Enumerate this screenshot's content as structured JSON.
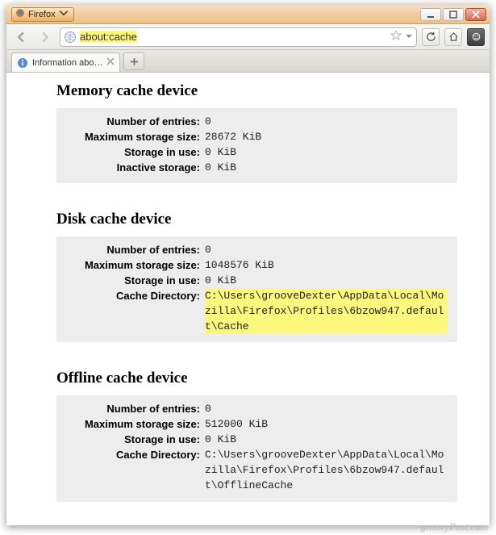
{
  "window": {
    "app_name": "Firefox",
    "address": "about:cache",
    "tab_title": "Information abo…"
  },
  "sections": [
    {
      "title": "Memory cache device",
      "rows": [
        {
          "label": "Number of entries:",
          "value": "0"
        },
        {
          "label": "Maximum storage size:",
          "value": "28672 KiB"
        },
        {
          "label": "Storage in use:",
          "value": "0 KiB"
        },
        {
          "label": "Inactive storage:",
          "value": "0 KiB"
        }
      ]
    },
    {
      "title": "Disk cache device",
      "rows": [
        {
          "label": "Number of entries:",
          "value": "0"
        },
        {
          "label": "Maximum storage size:",
          "value": "1048576 KiB"
        },
        {
          "label": "Storage in use:",
          "value": "0 KiB"
        },
        {
          "label": "Cache Directory:",
          "value": "C:\\Users\\grooveDexter\\AppData\\Local\\Mozilla\\Firefox\\Profiles\\6bzow947.default\\Cache",
          "highlight": true
        }
      ]
    },
    {
      "title": "Offline cache device",
      "rows": [
        {
          "label": "Number of entries:",
          "value": "0"
        },
        {
          "label": "Maximum storage size:",
          "value": "512000 KiB"
        },
        {
          "label": "Storage in use:",
          "value": "0 KiB"
        },
        {
          "label": "Cache Directory:",
          "value": "C:\\Users\\grooveDexter\\AppData\\Local\\Mozilla\\Firefox\\Profiles\\6bzow947.default\\OfflineCache"
        }
      ]
    }
  ],
  "watermark": "groovyPost.com"
}
